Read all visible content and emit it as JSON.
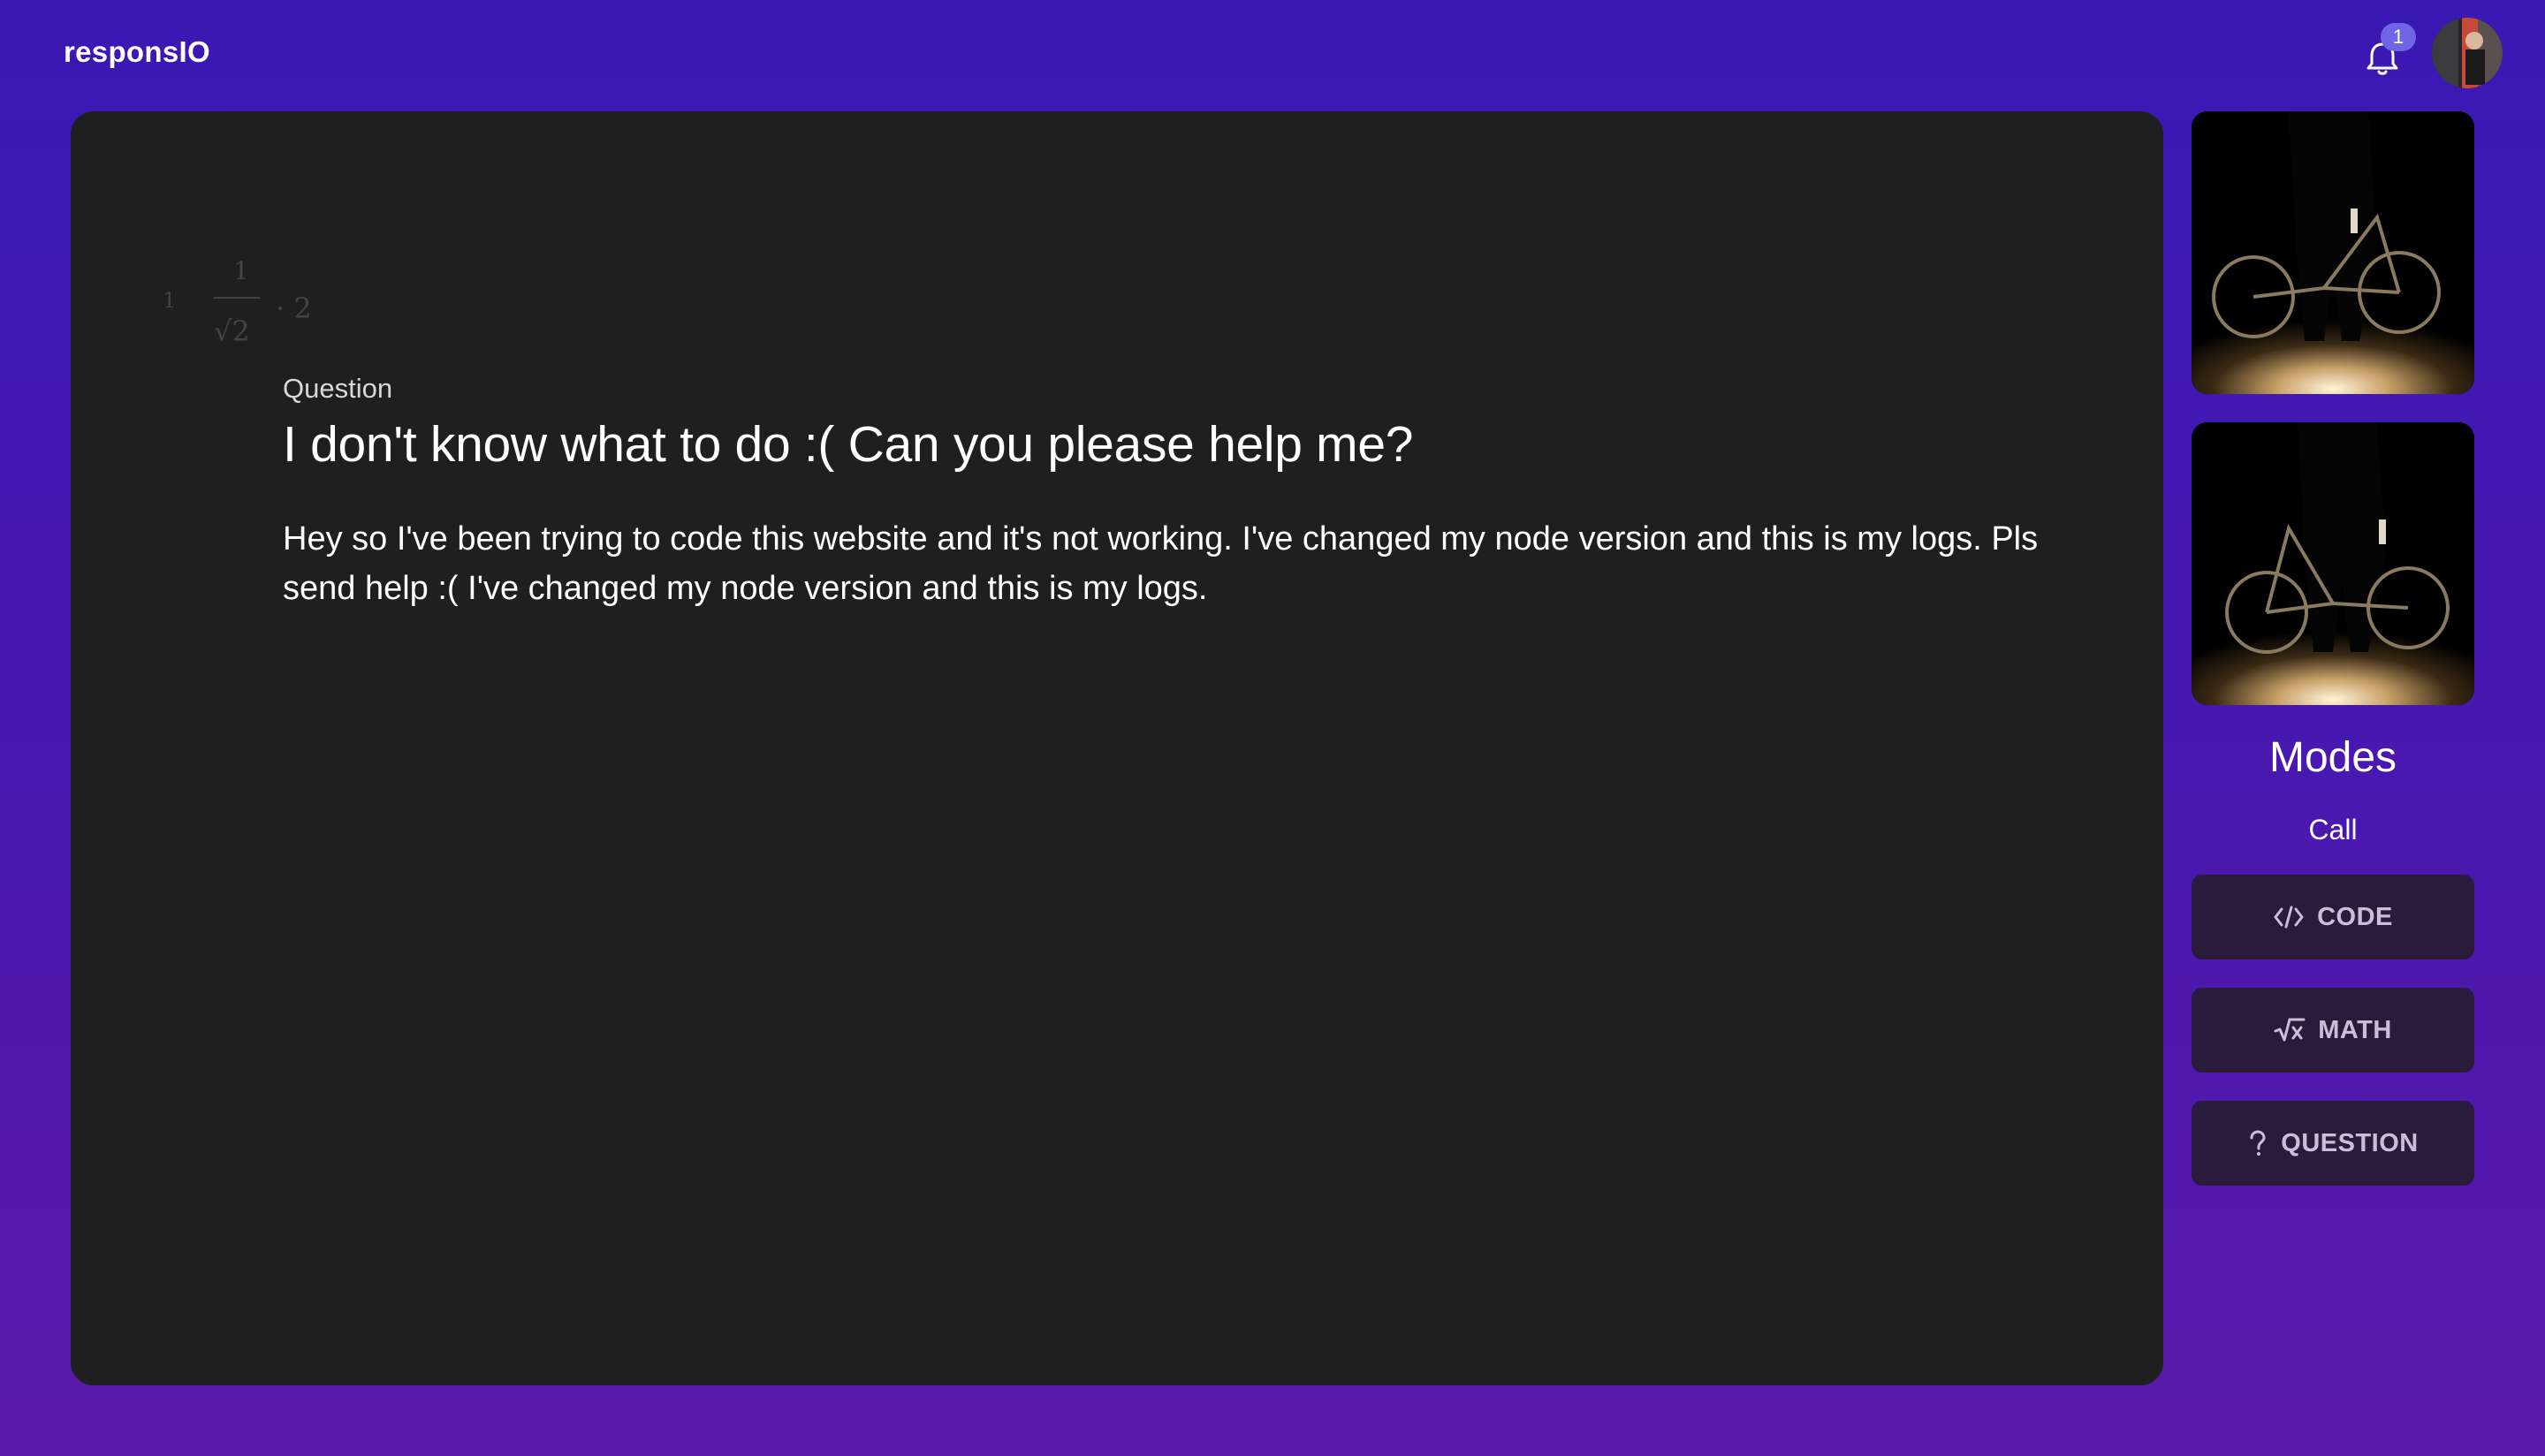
{
  "app": {
    "title": "responsIO"
  },
  "header": {
    "notification_count": "1"
  },
  "math_bg": {
    "left": "1",
    "numerator": "1",
    "radical": "√2",
    "tail": "· 2"
  },
  "question": {
    "kicker": "Question",
    "title": "I don't know what to do :( Can you please help me?",
    "body": "Hey so I've been trying to code this website and it's not working. I've changed my node version and this is my logs. Pls send help :( I've changed my node version and this is my logs."
  },
  "sidebar": {
    "modes_title": "Modes",
    "modes_subtitle": "Call",
    "buttons": [
      {
        "label": "CODE",
        "icon": "code-icon"
      },
      {
        "label": "MATH",
        "icon": "sqrt-icon"
      },
      {
        "label": "QUESTION",
        "icon": "question-icon"
      }
    ]
  },
  "colors": {
    "background_top": "#3a18b4",
    "background_bottom": "#5a18a8",
    "panel": "#1f1f1f",
    "mode_button": "#2a1b3d",
    "badge": "#6f66e6"
  }
}
